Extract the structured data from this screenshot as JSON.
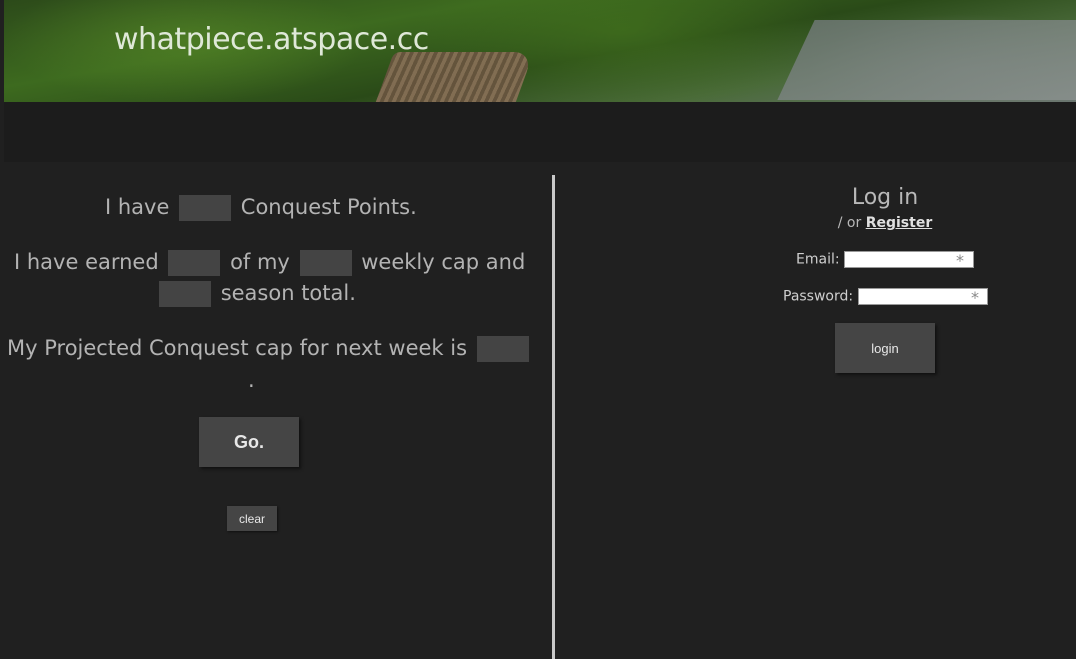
{
  "header": {
    "site_title": "whatpiece.atspace.cc"
  },
  "calculator": {
    "line1_prefix": "I have",
    "line1_suffix": "Conquest Points.",
    "line2_prefix": "I have earned",
    "line2_mid": "of my",
    "line2_suffix": "weekly cap and",
    "line3_suffix": "season total.",
    "line4_prefix": "My Projected Conquest cap for next week is",
    "line5": ".",
    "go_label": "Go.",
    "clear_label": "clear"
  },
  "login": {
    "title": "Log in",
    "sub_prefix": "/ or",
    "register_link": "Register",
    "email_label": "Email:",
    "password_label": "Password:",
    "required_marker": "*",
    "login_label": "login"
  }
}
